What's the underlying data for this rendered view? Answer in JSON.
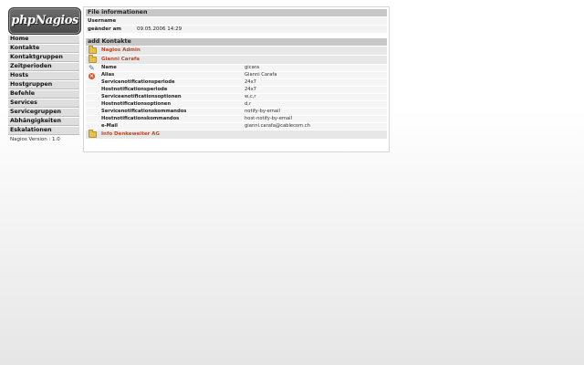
{
  "logo": {
    "text": "phpNagios"
  },
  "nav": {
    "items": [
      "Home",
      "Kontakte",
      "Kontaktgruppen",
      "Zeitperioden",
      "Hosts",
      "Hostgruppen",
      "Befehle",
      "Services",
      "Servicegruppen",
      "Abhängigkeiten",
      "Eskalationen"
    ],
    "version": "Nagios Version : 1.0"
  },
  "file_info": {
    "heading": "File informationen",
    "rows": [
      {
        "key": "Username",
        "value": ""
      },
      {
        "key": "geänder am",
        "value": "09.05.2006 14:29"
      }
    ]
  },
  "contacts": {
    "heading": "add Kontakte",
    "items": [
      "Nagios Admin",
      "Gianni Carafa"
    ],
    "detail": [
      {
        "key": "Name",
        "value": "gicara"
      },
      {
        "key": "Alias",
        "value": "Gianni Carafa"
      },
      {
        "key": "Servicenotificationsperiode",
        "value": "24x7"
      },
      {
        "key": "Hostnotificationsperiode",
        "value": "24x7"
      },
      {
        "key": "Serviceenotificationsoptionen",
        "value": "w,c,r"
      },
      {
        "key": "Hostnotificationsoptionen",
        "value": "d,r"
      },
      {
        "key": "Servicenotificationskommandos",
        "value": "notify-by-email"
      },
      {
        "key": "Hostnotificationskommandos",
        "value": "host-notify-by-email"
      },
      {
        "key": "e-Mail",
        "value": "gianni.carafa@cablecom.ch"
      }
    ],
    "footer_item": "Info Denkeweiter AG"
  },
  "icons": {
    "folder": "folder-icon",
    "edit": "edit-icon",
    "delete": "delete-icon"
  }
}
